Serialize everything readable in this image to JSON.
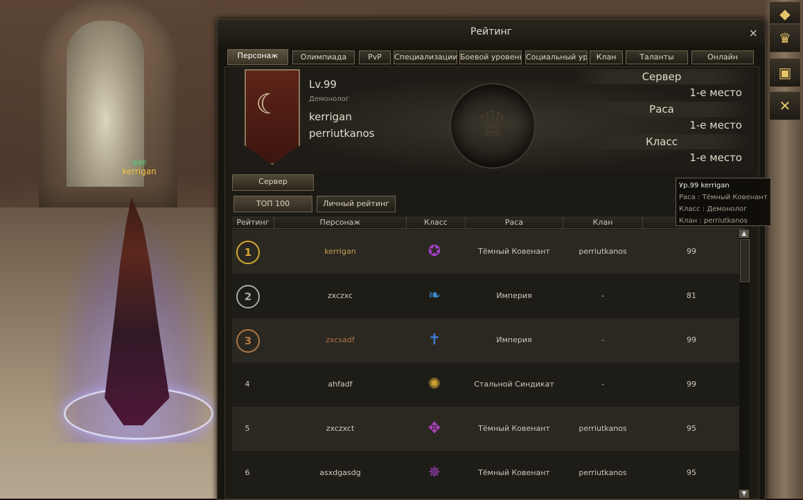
{
  "scene": {
    "nameplate_title": "qqe",
    "nameplate_name": "kerrigan"
  },
  "sidebar": {
    "icons": [
      "compass-icon",
      "trophy-icon",
      "shopping-bag-icon",
      "crossed-axes-icon"
    ]
  },
  "window": {
    "title": "Рейтинг",
    "close_label": "×",
    "tabs": [
      "Персонаж",
      "Олимпиада",
      "PvP",
      "Специализации",
      "Боевой уровень",
      "Социальный ур.",
      "Клан",
      "Таланты",
      "Онлайн"
    ],
    "active_tab": "Персонаж"
  },
  "profile": {
    "level": "Lv.99",
    "class": "Демонолог",
    "name": "kerrigan",
    "clan": "perriutkanos",
    "rankings": [
      {
        "label": "Сервер",
        "value": "1-е место"
      },
      {
        "label": "Раса",
        "value": "1-е место"
      },
      {
        "label": "Класс",
        "value": "1-е место"
      }
    ]
  },
  "server_tab": "Сервер",
  "buttons": {
    "top100": "ТОП 100",
    "personal": "Личный рейтинг"
  },
  "table": {
    "headers": [
      "Рейтинг",
      "Персонаж",
      "Класс",
      "Раса",
      "Клан",
      ""
    ],
    "rows": [
      {
        "rank": "1",
        "name": "kerrigan",
        "race": "Тёмный Ковенант",
        "clan": "perriutkanos",
        "level": "99",
        "rank_color": "#d8a830",
        "name_color": "#c8a050",
        "class_icon": "pentagram-icon",
        "class_color": "#a040c0"
      },
      {
        "rank": "2",
        "name": "zxczxc",
        "race": "Империя",
        "clan": "-",
        "level": "81",
        "rank_color": "#a8a8a8",
        "name_color": "#cfc8b8",
        "class_icon": "dragon-icon",
        "class_color": "#3a8ad0"
      },
      {
        "rank": "3",
        "name": "zxcsadf",
        "race": "Империя",
        "clan": "-",
        "level": "99",
        "rank_color": "#b07840",
        "name_color": "#b07040",
        "class_icon": "sword-icon",
        "class_color": "#3a7ad0"
      },
      {
        "rank": "4",
        "name": "ahfadf",
        "race": "Стальной Синдикат",
        "clan": "-",
        "level": "99",
        "rank_color": "",
        "name_color": "#cfc8b8",
        "class_icon": "gear-icon",
        "class_color": "#c8a030"
      },
      {
        "rank": "5",
        "name": "zxczxct",
        "race": "Тёмный Ковенант",
        "clan": "perriutkanos",
        "level": "95",
        "rank_color": "",
        "name_color": "#cfc8b8",
        "class_icon": "winged-staff-icon",
        "class_color": "#b040c0"
      },
      {
        "rank": "6",
        "name": "asxdgasdg",
        "race": "Тёмный Ковенант",
        "clan": "perriutkanos",
        "level": "95",
        "rank_color": "",
        "name_color": "#cfc8b8",
        "class_icon": "spiked-icon",
        "class_color": "#a040c0"
      }
    ]
  },
  "tooltip": {
    "header": "Ур.99 kerrigan",
    "race": "Раса : Тёмный Ковенант",
    "class": "Класс : Демонолог",
    "clan": "Клан : perriutkanos"
  },
  "scroll": {
    "up": "▲",
    "down": "▼"
  }
}
